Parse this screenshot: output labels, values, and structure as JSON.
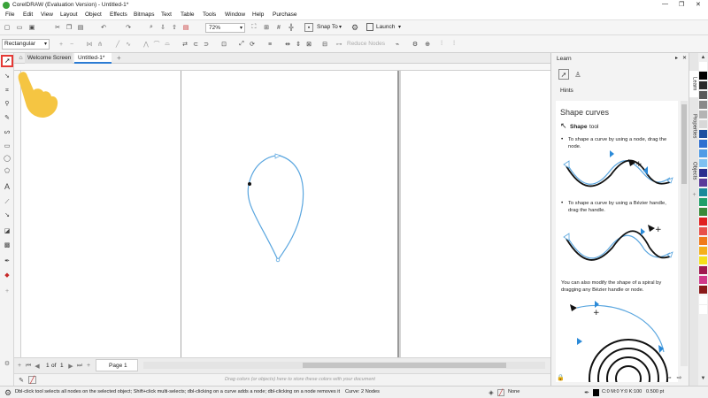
{
  "titlebar": {
    "title": "CorelDRAW (Evaluation Version) - Untitled-1*",
    "minimize": "—",
    "maximize": "❐",
    "close": "✕"
  },
  "menu": [
    "File",
    "Edit",
    "View",
    "Layout",
    "Object",
    "Effects",
    "Bitmaps",
    "Text",
    "Table",
    "Tools",
    "Window",
    "Help",
    "Purchase"
  ],
  "standard_toolbar": {
    "zoom_value": "72%",
    "snap_to_label": "Snap To",
    "launch_label": "Launch"
  },
  "property_bar": {
    "selection_mode": "Rectangular",
    "reduce_nodes_label": "Reduce Nodes"
  },
  "tabs": {
    "welcome": "Welcome Screen",
    "document": "Untitled-1*",
    "add": "+"
  },
  "canvas": {
    "curve_color": "#5aa6df",
    "node_color": "#111111"
  },
  "page_nav": {
    "current": "1",
    "of": "of",
    "total": "1",
    "page_tab": "Page 1"
  },
  "color_well_hint": "Drag colors (or objects) here to store these colors with your document",
  "docker": {
    "panel_title": "Learn",
    "hints_label": "Hints",
    "heading": "Shape curves",
    "tool_name": "Shape",
    "tool_suffix": "tool",
    "bullet1": "To shape a curve by using a node, drag the node.",
    "bullet2": "To shape a curve by using a Bézier handle, drag the handle.",
    "para3": "You can also modify the shape of a spiral by dragging any Bézier handle or node."
  },
  "docker_tabs": [
    "Learn",
    "Properties",
    "Objects"
  ],
  "palette_colors": [
    "#ffffff",
    "#000000",
    "#2a2a2a",
    "#5a5a5a",
    "#8a8a8a",
    "#b4b4b4",
    "#d8d8d8",
    "#1b4fa0",
    "#2f6fd0",
    "#4f9be6",
    "#7fc0f0",
    "#2b2f8f",
    "#5a3b9a",
    "#1a8a9a",
    "#1fa06a",
    "#3a8a3a",
    "#e02020",
    "#e8504a",
    "#f07a1a",
    "#f5b01a",
    "#f5e01a",
    "#a01a50",
    "#d03a8a",
    "#8a1a1a",
    "#ffffff",
    "#ffffff"
  ],
  "status": {
    "hint": "Dbl-click tool selects all nodes on the selected object; Shift+click multi-selects; dbl-clicking on a curve adds a node; dbl-clicking on a node removes it",
    "object_info": "Curve: 2 Nodes",
    "fill_label": "None",
    "outline_info": "C:0 M:0 Y:0 K:100   0.500 pt"
  },
  "tutorial_overlay": {
    "hand_icon": "pointing-hand",
    "highlight_color": "#e53935"
  }
}
